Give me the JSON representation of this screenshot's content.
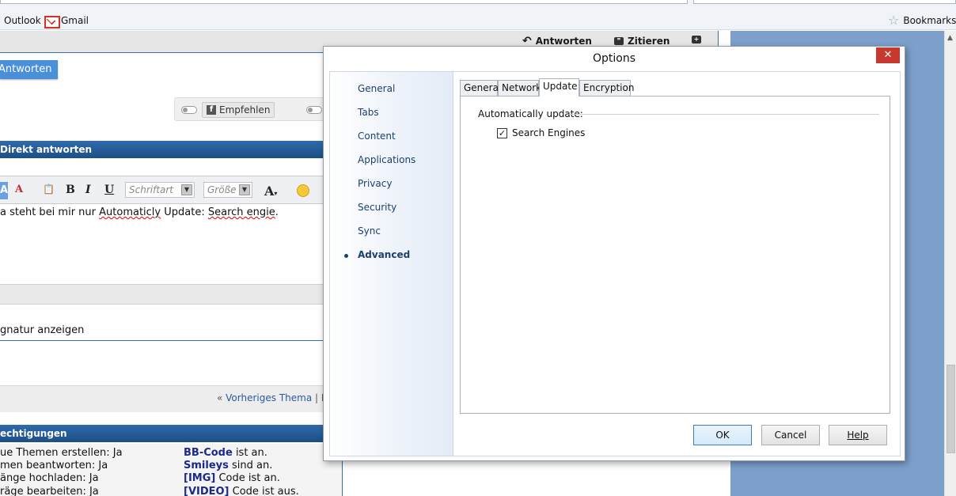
{
  "browser": {
    "bookmarks": {
      "outlook": "Outlook",
      "gmail": "Gmail",
      "bookmarks": "Bookmarks"
    }
  },
  "forum": {
    "top_actions": {
      "reply": "Antworten",
      "quote": "Zitieren"
    },
    "reply_button": "Antworten",
    "share": {
      "recommend": "Empfehlen"
    },
    "quick_reply_header": "Direkt antworten",
    "editor": {
      "font_placeholder": "Schriftart",
      "size_placeholder": "Größe",
      "text_prefix": "a steht bei mir nur ",
      "text_word1": "Automaticly",
      "text_mid": " Update: ",
      "text_word2": "Search engie",
      "text_suffix": "."
    },
    "signature_label": "gnatur anzeigen",
    "nav": {
      "prev_prefix": "« ",
      "prev_thread": "Vorheriges Thema",
      "separator": " | F"
    },
    "permissions_header": "echtigungen",
    "permissions": [
      {
        "left": "ue Themen erstellen: Ja",
        "code": "BB-Code",
        "status": " ist an."
      },
      {
        "left": "men beantworten: Ja",
        "code": "Smileys",
        "status": " sind an."
      },
      {
        "left": "änge hochladen: Ja",
        "code": "[IMG]",
        "status": " Code ist an."
      },
      {
        "left": "räge bearbeiten: Ja",
        "code": "[VIDEO]",
        "status": " Code ist aus."
      }
    ]
  },
  "dialog": {
    "title": "Options",
    "close": "✕",
    "categories": [
      "General",
      "Tabs",
      "Content",
      "Applications",
      "Privacy",
      "Security",
      "Sync",
      "Advanced"
    ],
    "active_category": "Advanced",
    "tabs": [
      "General",
      "Network",
      "Update",
      "Encryption"
    ],
    "active_tab": "Update",
    "group_label": "Automatically update:",
    "checkbox_label": "Search Engines",
    "checkbox_checked": true,
    "buttons": {
      "ok": "OK",
      "cancel": "Cancel",
      "help": "Help"
    }
  }
}
